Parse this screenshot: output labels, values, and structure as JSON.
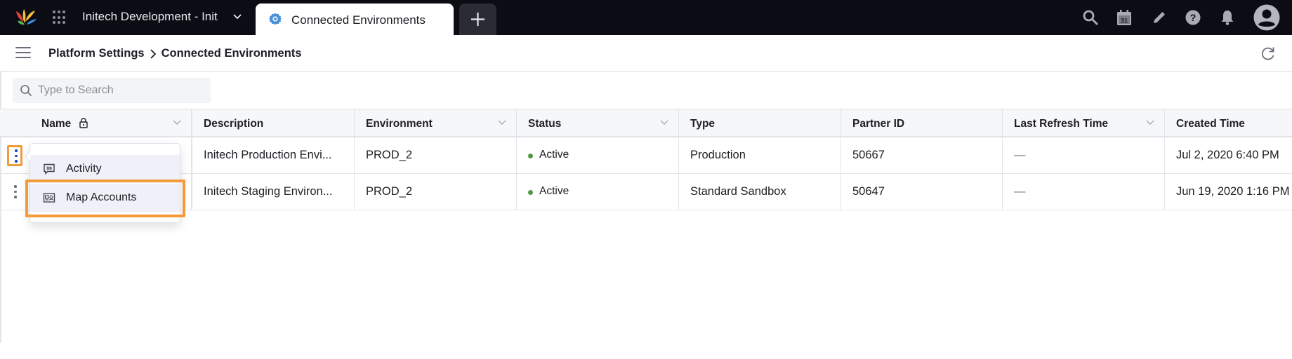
{
  "topbar": {
    "workspace_title": "Initech Development - Init",
    "active_tab": {
      "label": "Connected Environments",
      "icon": "gear-icon"
    },
    "add_tab_icon": "plus-icon",
    "icons": [
      "search-icon",
      "calendar-icon",
      "pencil-icon",
      "help-icon",
      "bell-icon",
      "avatar-icon"
    ],
    "calendar_day": "31"
  },
  "breadcrumb": {
    "items": [
      "Platform Settings",
      "Connected Environments"
    ]
  },
  "search": {
    "placeholder": "Type to Search",
    "value": ""
  },
  "table": {
    "columns": [
      {
        "label": "Name",
        "locked": true,
        "sortable": true
      },
      {
        "label": "Description",
        "sortable": false
      },
      {
        "label": "Environment",
        "sortable": true
      },
      {
        "label": "Status",
        "sortable": true
      },
      {
        "label": "Type",
        "sortable": false
      },
      {
        "label": "Partner ID",
        "sortable": false
      },
      {
        "label": "Last Refresh Time",
        "sortable": true
      },
      {
        "label": "Created Time",
        "sortable": false
      }
    ],
    "rows": [
      {
        "name": "",
        "description": "Initech Production Envi...",
        "environment": "PROD_2",
        "status": "Active",
        "type": "Production",
        "partner_id": "50667",
        "last_refresh_time": "—",
        "created_time": "Jul 2, 2020 6:40 PM",
        "menu_open": true
      },
      {
        "name": "",
        "description": "Initech Staging Environ...",
        "environment": "PROD_2",
        "status": "Active",
        "type": "Standard Sandbox",
        "partner_id": "50647",
        "last_refresh_time": "—",
        "created_time": "Jun 19, 2020 1:16 PM",
        "menu_open": false
      }
    ]
  },
  "row_menu": {
    "items": [
      {
        "label": "Activity",
        "icon": "quote-bubble-icon"
      },
      {
        "label": "Map Accounts",
        "icon": "map-accounts-icon",
        "highlighted": true
      }
    ]
  },
  "colors": {
    "topbar_bg": "#0c0d14",
    "accent_highlight": "#f29b38",
    "status_active": "#4e9a3f",
    "kebab_active": "#2443c8",
    "tab_gear": "#4a90d9"
  }
}
